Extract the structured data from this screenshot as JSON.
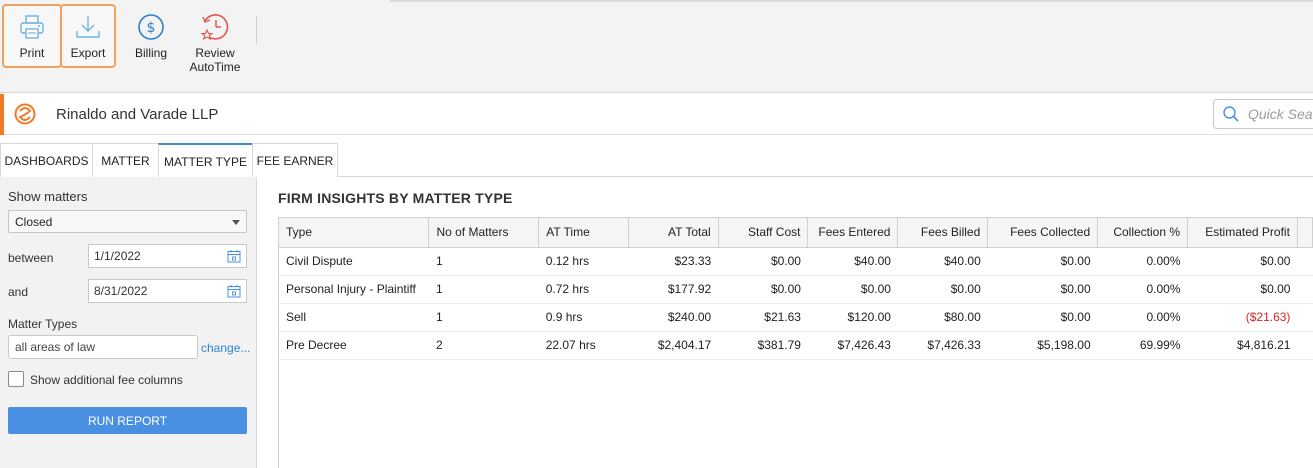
{
  "ribbon": {
    "print_label": "Print",
    "export_label": "Export",
    "billing_label": "Billing",
    "review_label_line1": "Review",
    "review_label_line2": "AutoTime"
  },
  "header": {
    "firm_name": "Rinaldo and Varade LLP",
    "search_placeholder": "Quick Search"
  },
  "tabs": [
    {
      "label": "DASHBOARDS"
    },
    {
      "label": "MATTER"
    },
    {
      "label": "MATTER TYPE"
    },
    {
      "label": "FEE EARNER"
    }
  ],
  "filters": {
    "show_matters_label": "Show matters",
    "status_value": "Closed",
    "between_label": "between",
    "start_date": "1/1/2022",
    "and_label": "and",
    "end_date": "8/31/2022",
    "matter_types_label": "Matter Types",
    "matter_types_value": "all areas of law",
    "change_link": "change...",
    "fee_columns_label": "Show additional fee columns",
    "fee_columns_checked": false,
    "run_button": "RUN REPORT"
  },
  "report": {
    "title": "FIRM INSIGHTS BY MATTER TYPE",
    "columns": [
      "Type",
      "No of Matters",
      "AT Time",
      "AT Total",
      "Staff Cost",
      "Fees Entered",
      "Fees Billed",
      "Fees Collected",
      "Collection %",
      "Estimated Profit"
    ],
    "rows": [
      [
        "Civil Dispute",
        "1",
        "0.12 hrs",
        "$23.33",
        "$0.00",
        "$40.00",
        "$40.00",
        "$0.00",
        "0.00%",
        "$0.00"
      ],
      [
        "Personal Injury - Plaintiff",
        "1",
        "0.72 hrs",
        "$177.92",
        "$0.00",
        "$0.00",
        "$0.00",
        "$0.00",
        "0.00%",
        "$0.00"
      ],
      [
        "Sell",
        "1",
        "0.9 hrs",
        "$240.00",
        "$21.63",
        "$120.00",
        "$80.00",
        "$0.00",
        "0.00%",
        "($21.63)"
      ],
      [
        "Pre Decree",
        "2",
        "22.07 hrs",
        "$2,404.17",
        "$381.79",
        "$7,426.43",
        "$7,426.33",
        "$5,198.00",
        "69.99%",
        "$4,816.21"
      ]
    ]
  },
  "colors": {
    "accent_orange": "#f07a28",
    "tab_active": "#3e8ed0",
    "run_button": "#4a90e2",
    "negative": "#d9232a",
    "link": "#2f86d0"
  }
}
